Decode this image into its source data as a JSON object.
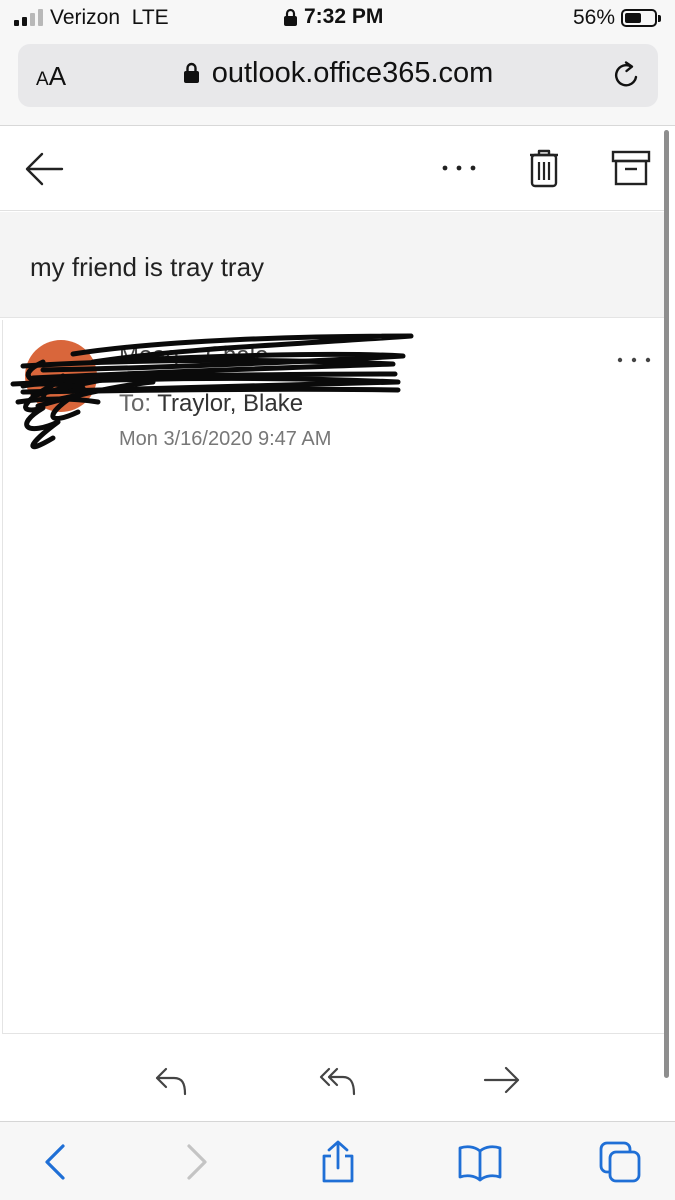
{
  "status_bar": {
    "carrier": "Verizon",
    "network": "LTE",
    "time": "7:32 PM",
    "battery_percent": "56%",
    "battery_level": 0.56,
    "signal_bars_active": 2,
    "signal_bars_total": 4
  },
  "browser": {
    "text_size_label_small": "A",
    "text_size_label_large": "A",
    "url": "outlook.office365.com"
  },
  "email": {
    "subject": "my friend is tray tray",
    "sender": "Meag... Chale",
    "to_label": "To:",
    "to_value": "Traylor, Blake",
    "date": "Mon 3/16/2020 9:47 AM",
    "avatar_color": "#d9663b"
  },
  "colors": {
    "accent": "#1f6fd6",
    "disabled": "#c4c4c4",
    "icon": "#333333"
  },
  "icons": {
    "back": "back-arrow-icon",
    "more": "more-horizontal-icon",
    "delete": "trash-icon",
    "archive": "archive-icon",
    "reply": "reply-icon",
    "reply_all": "reply-all-icon",
    "forward": "forward-icon",
    "nav_back": "chevron-left-icon",
    "nav_forward": "chevron-right-icon",
    "share": "share-icon",
    "bookmarks": "book-icon",
    "tabs": "tabs-icon"
  }
}
